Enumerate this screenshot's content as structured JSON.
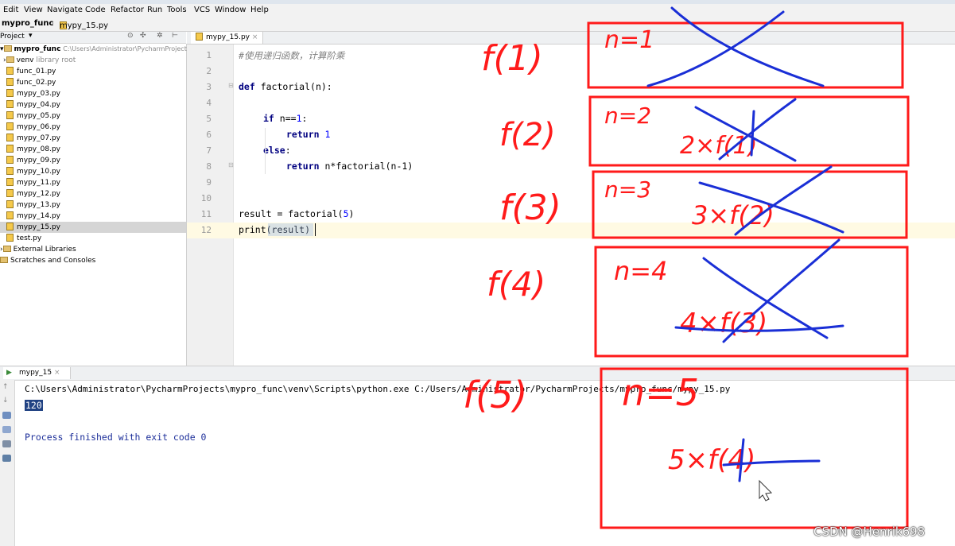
{
  "menu": [
    "Edit",
    "View",
    "Navigate",
    "Code",
    "Refactor",
    "Run",
    "Tools",
    "VCS",
    "Window",
    "Help"
  ],
  "breadcrumb": {
    "project": "mypro_func",
    "file": "mypy_15.py"
  },
  "project_panel": {
    "label": "Project",
    "root": "mypro_func",
    "root_path": "C:\\Users\\Administrator\\PycharmProject",
    "venv": "venv",
    "venv_note": "library root"
  },
  "files": [
    "func_01.py",
    "func_02.py",
    "mypy_03.py",
    "mypy_04.py",
    "mypy_05.py",
    "mypy_06.py",
    "mypy_07.py",
    "mypy_08.py",
    "mypy_09.py",
    "mypy_10.py",
    "mypy_11.py",
    "mypy_12.py",
    "mypy_13.py",
    "mypy_14.py",
    "mypy_15.py",
    "test.py"
  ],
  "external_libraries": "External Libraries",
  "scratches": "Scratches and Consoles",
  "editor_tab": "mypy_15.py",
  "line_numbers": [
    "1",
    "2",
    "3",
    "4",
    "5",
    "6",
    "7",
    "8",
    "9",
    "10",
    "11",
    "12"
  ],
  "code": {
    "l1": "#使用递归函数，计算阶乘",
    "l3_kw": "def",
    "l3_rest": " factorial(n):",
    "l5_kw": "if",
    "l5_rest": " n==",
    "l5_num": "1",
    "l5_end": ":",
    "l6_kw": "return",
    "l6_num": " 1",
    "l7_kw": "else",
    "l7_end": ":",
    "l8_kw": "return",
    "l8_rest": " n*factorial(n-1)",
    "l11_a": "result = factorial(",
    "l11_num": "5",
    "l11_b": ")",
    "l12": "print(result)"
  },
  "run_tab": "mypy_15",
  "console": {
    "command": "C:\\Users\\Administrator\\PycharmProjects\\mypro_func\\venv\\Scripts\\python.exe C:/Users/Administrator/PycharmProjects/mypro_func/mypy_15.py",
    "output": "120",
    "finished": "Process finished with exit code 0"
  },
  "annotations": {
    "f1": "f(1)",
    "f2": "f(2)",
    "f3": "f(3)",
    "f4": "f(4)",
    "f5": "f(5)",
    "n1": "n=1",
    "n2": "n=2",
    "n3": "n=3",
    "n4": "n=4",
    "n5": "n=5",
    "e2": "2×f(1)",
    "e3": "3×f(2)",
    "e4": "4×f(3)",
    "e5": "5×f(4)",
    "ink_red": "#ff1a1a",
    "ink_blue": "#1a2fd6"
  },
  "watermark": "CSDN @Henrik698"
}
